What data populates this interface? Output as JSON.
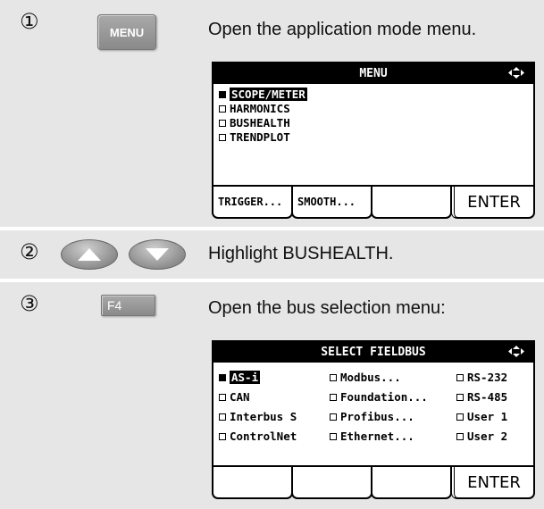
{
  "steps": [
    {
      "number": "①",
      "key_label": "MENU",
      "instruction": "Open the application mode menu.",
      "screen": {
        "title": "MENU",
        "items": [
          {
            "label": "SCOPE/METER",
            "selected": true
          },
          {
            "label": "HARMONICS",
            "selected": false
          },
          {
            "label": "BUSHEALTH",
            "selected": false
          },
          {
            "label": "TRENDPLOT",
            "selected": false
          }
        ],
        "softkeys": [
          "TRIGGER...",
          "SMOOTH...",
          "",
          "ENTER"
        ]
      }
    },
    {
      "number": "②",
      "keys": [
        "up-arrow",
        "down-arrow"
      ],
      "instruction": "Highlight BUSHEALTH."
    },
    {
      "number": "③",
      "key_label": "F4",
      "instruction": "Open the bus selection menu:",
      "screen": {
        "title": "SELECT FIELDBUS",
        "columns": [
          [
            {
              "label": "AS-i",
              "selected": true
            },
            {
              "label": "CAN",
              "selected": false
            },
            {
              "label": "Interbus S",
              "selected": false
            },
            {
              "label": "ControlNet",
              "selected": false
            }
          ],
          [
            {
              "label": "Modbus...",
              "selected": false
            },
            {
              "label": "Foundation...",
              "selected": false
            },
            {
              "label": "Profibus...",
              "selected": false
            },
            {
              "label": "Ethernet...",
              "selected": false
            }
          ],
          [
            {
              "label": "RS-232",
              "selected": false
            },
            {
              "label": "RS-485",
              "selected": false
            },
            {
              "label": "User 1",
              "selected": false
            },
            {
              "label": "User 2",
              "selected": false
            }
          ]
        ],
        "softkeys": [
          "",
          "",
          "",
          "ENTER"
        ]
      }
    }
  ]
}
